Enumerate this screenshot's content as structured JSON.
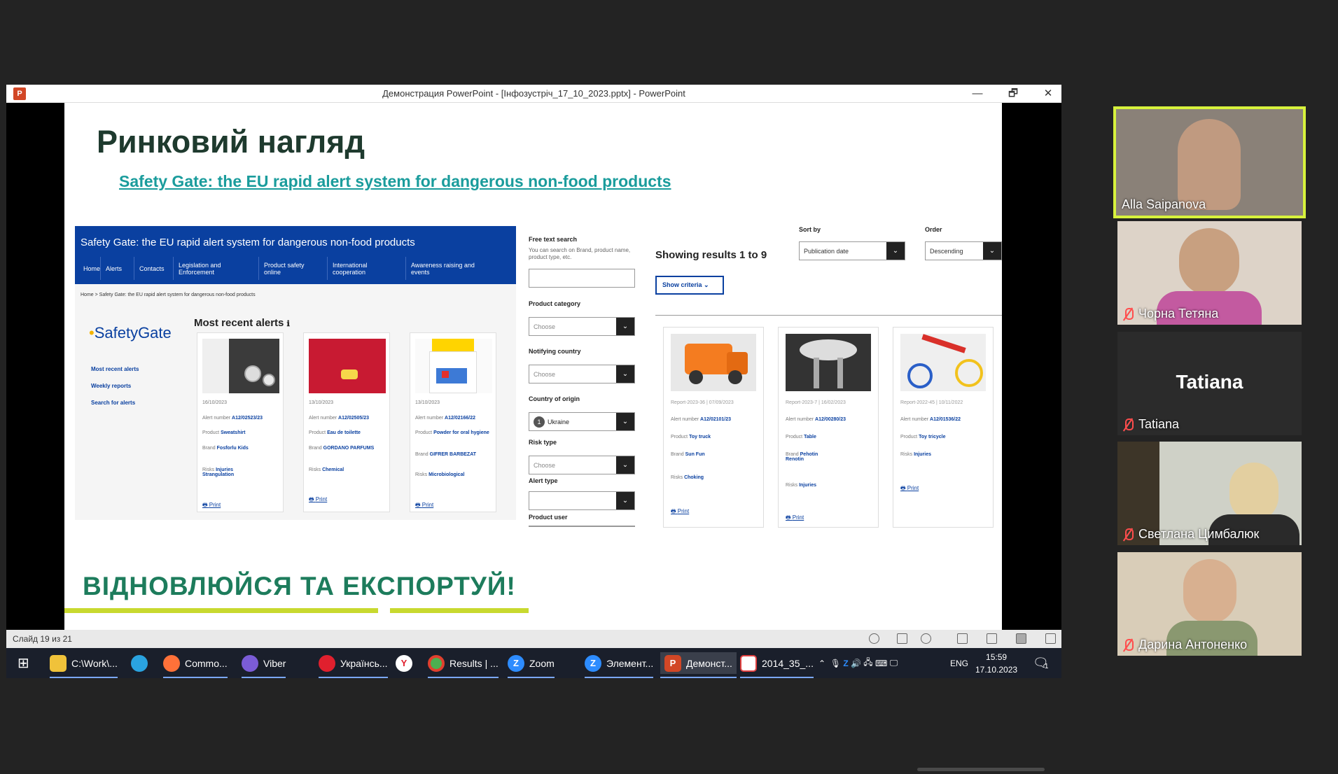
{
  "powerpoint": {
    "window_title": "Демонстрация PowerPoint - [Інфозустріч_17_10_2023.pptx] - PowerPoint",
    "app_icon": "P",
    "minimize": "—",
    "restore": "🗗",
    "close": "✕",
    "slide_counter": "Слайд 19 из 21"
  },
  "slide": {
    "title": "Ринковий нагляд",
    "link": "Safety Gate: the EU rapid alert system for dangerous non-food products",
    "footer": "ВІДНОВЛЮЙСЯ ТА ЕКСПОРТУЙ!",
    "safety_gate": {
      "header_title": "Safety Gate: the EU rapid alert system for dangerous non-food products",
      "nav": [
        "Home",
        "Alerts",
        "Contacts",
        "Legislation and Enforcement",
        "Product safety online",
        "International cooperation",
        "Awareness raising and events"
      ],
      "breadcrumb": "Home  >  Safety Gate: the EU rapid alert system for dangerous non-food products",
      "logo_text": "SafetyGate",
      "logo_dot": "•",
      "side_links": [
        "Most recent alerts",
        "Weekly reports",
        "Search for alerts"
      ],
      "most_recent_title": "Most recent alerts",
      "info_icon": "ℹ",
      "cards": [
        {
          "date": "16/10/2023",
          "alert_label": "Alert number",
          "alert": "A12/02523/23",
          "product_label": "Product",
          "product": "Sweatshirt",
          "brand_label": "Brand",
          "brand": "Fosforlu Kids",
          "risks_label": "Risks",
          "risks": "Injuries Strangulation",
          "print": "Print"
        },
        {
          "date": "13/10/2023",
          "alert_label": "Alert number",
          "alert": "A12/02505/23",
          "product_label": "Product",
          "product": "Eau de toilette",
          "brand_label": "Brand",
          "brand": "GORDANO PARFUMS",
          "risks_label": "Risks",
          "risks": "Chemical",
          "print": "Print"
        },
        {
          "date": "13/10/2023",
          "alert_label": "Alert number",
          "alert": "A12/02166/22",
          "product_label": "Product",
          "product": "Powder for oral hygiene",
          "brand_label": "Brand",
          "brand": "GIFRER BARBEZAT",
          "risks_label": "Risks",
          "risks": "Microbiological",
          "print": "Print"
        }
      ]
    },
    "filters": {
      "free_text_label": "Free text search",
      "free_text_hint": "You can search on Brand, product name, product type, etc.",
      "product_category_label": "Product category",
      "product_category_value": "Choose",
      "notifying_country_label": "Notifying country",
      "notifying_country_value": "Choose",
      "country_origin_label": "Country of origin",
      "country_origin_badge": "1",
      "country_origin_value": "Ukraine",
      "risk_type_label": "Risk type",
      "risk_type_value": "Choose",
      "alert_type_label": "Alert type",
      "product_user_label": "Product user",
      "arrow": "⌄"
    },
    "results": {
      "title": "Showing results 1 to 9",
      "show_criteria": "Show criteria",
      "sort_by_label": "Sort by",
      "sort_by_value": "Publication date",
      "order_label": "Order",
      "order_value": "Descending",
      "cards": [
        {
          "report": "Report-2023-36 | 07/09/2023",
          "alert_label": "Alert number",
          "alert": "A12/02101/23",
          "product_label": "Product",
          "product": "Toy truck",
          "brand_label": "Brand",
          "brand": "Sun Fun",
          "risks_label": "Risks",
          "risks": "Choking",
          "print": "Print"
        },
        {
          "report": "Report-2023-7 | 16/02/2023",
          "alert_label": "Alert number",
          "alert": "A12/00280/23",
          "product_label": "Product",
          "product": "Table",
          "brand_label": "Brand",
          "brand": "Pehotin Renotin",
          "risks_label": "Risks",
          "risks": "Injuries",
          "print": "Print"
        },
        {
          "report": "Report-2022-45 | 10/11/2022",
          "alert_label": "Alert number",
          "alert": "A12/01536/22",
          "product_label": "Product",
          "product": "Toy tricycle",
          "risks_label": "Risks",
          "risks": "Injuries",
          "print": "Print"
        }
      ]
    }
  },
  "taskbar": {
    "items": [
      {
        "label": "C:\\Work\\...",
        "icon": "folder-icon",
        "color": "#f0c23a"
      },
      {
        "label": "",
        "icon": "telegram-icon",
        "color": "#2aa3e0"
      },
      {
        "label": "Commo...",
        "icon": "firefox-icon",
        "color": "#ff7139"
      },
      {
        "label": "Viber",
        "icon": "viber-icon",
        "color": "#7b5cd6"
      },
      {
        "label": "Українсь...",
        "icon": "opera-icon",
        "color": "#e0202e"
      },
      {
        "label": "",
        "icon": "yandex-icon",
        "color": "#fff"
      },
      {
        "label": "Results | ...",
        "icon": "chrome-icon",
        "color": "#4caf50"
      },
      {
        "label": "Zoom",
        "icon": "zoom-icon",
        "color": "#2d8cff"
      },
      {
        "label": "Элемент...",
        "icon": "zoom-icon",
        "color": "#2d8cff"
      },
      {
        "label": "Демонст...",
        "icon": "powerpoint-icon",
        "color": "#d24726"
      },
      {
        "label": "2014_35_...",
        "icon": "pdf-icon",
        "color": "#e04040"
      }
    ],
    "lang": "ENG",
    "time": "15:59",
    "date": "17.10.2023",
    "notifications": "1"
  },
  "participants": [
    {
      "name": "Alla Saipanova",
      "muted": false,
      "active": true
    },
    {
      "name": "Чорна Тетяна",
      "muted": true,
      "active": false
    },
    {
      "name": "Tatiana",
      "muted": true,
      "active": false,
      "no_video": true
    },
    {
      "name": "Светлана Цимбалюк",
      "muted": true,
      "active": false
    },
    {
      "name": "Дарина Антоненко",
      "muted": true,
      "active": false
    }
  ],
  "colors": {
    "sg_blue": "#0a40a0",
    "title_green": "#1e3a2e",
    "link_teal": "#1a9c9c",
    "footer_green": "#1d7c5c",
    "accent_yellow": "#c8d92f",
    "active_speaker": "#d7f23c"
  }
}
